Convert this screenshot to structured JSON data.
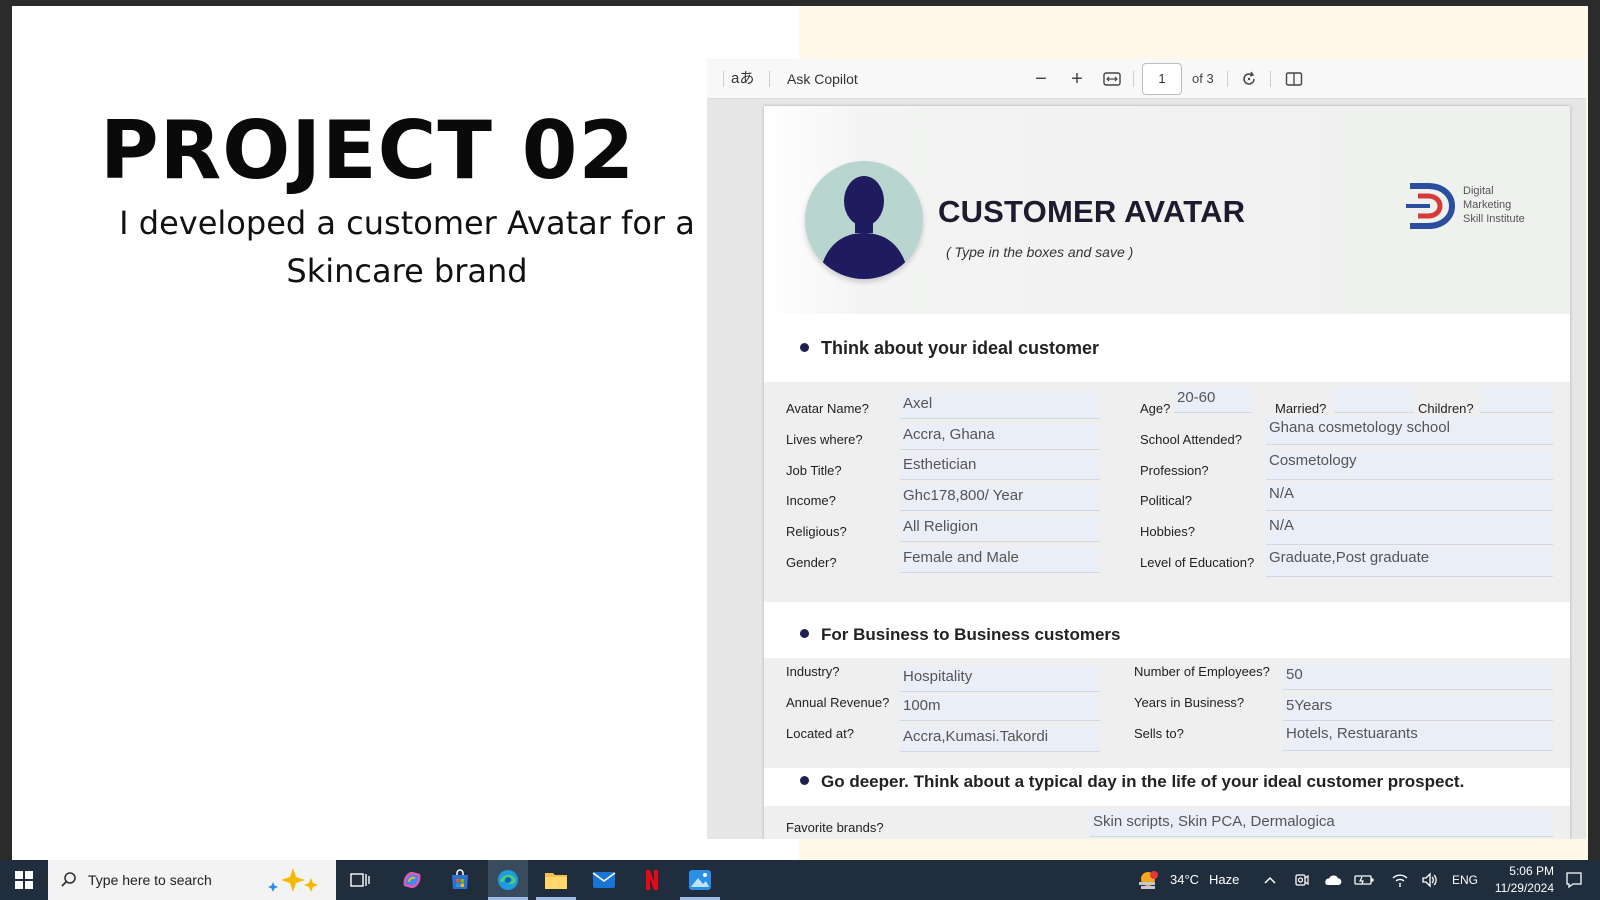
{
  "slide": {
    "title": "PROJECT 02",
    "subtitle": "I developed a customer Avatar for a Skincare brand"
  },
  "pdf_toolbar": {
    "translate_icon": "aあ",
    "ask_copilot": "Ask Copilot",
    "zoom_out": "−",
    "zoom_in": "+",
    "page_number": "1",
    "page_total": "of 3"
  },
  "document": {
    "title": "CUSTOMER AVATAR",
    "instruction": "( Type in the boxes and save )",
    "logo_lines": [
      "Digital",
      "Marketing",
      "Skill Institute"
    ],
    "section1_heading": "Think about your ideal customer",
    "section1": {
      "avatar_name_label": "Avatar Name?",
      "avatar_name": "Axel",
      "lives_label": "Lives where?",
      "lives": "Accra, Ghana",
      "job_label": "Job Title?",
      "job": "Esthetician",
      "income_label": "Income?",
      "income": "Ghc178,800/ Year",
      "religious_label": "Religious?",
      "religious": "All Religion",
      "gender_label": "Gender?",
      "gender": "Female and Male",
      "age_label": "Age?",
      "age": "20-60",
      "married_label": "Married?",
      "married": "",
      "children_label": "Children?",
      "children": "",
      "school_label": "School Attended?",
      "school": "Ghana cosmetology school",
      "profession_label": "Profession?",
      "profession": "Cosmetology",
      "political_label": "Political?",
      "political": "N/A",
      "hobbies_label": "Hobbies?",
      "hobbies": "N/A",
      "education_label": "Level of Education?",
      "education": "Graduate,Post graduate"
    },
    "section2_heading": "For Business to Business customers",
    "section2": {
      "industry_label": "Industry?",
      "industry": "Hospitality",
      "revenue_label": "Annual Revenue?",
      "revenue": "100m",
      "located_label": "Located at?",
      "located": "Accra,Kumasi.Takordi",
      "employees_label": "Number of Employees?",
      "employees": "50",
      "years_label": "Years in Business?",
      "years": "5Years",
      "sells_label": "Sells to?",
      "sells": "Hotels, Restuarants"
    },
    "section3_heading": "Go deeper. Think about a typical day in the life of your ideal customer prospect.",
    "section3": {
      "brands_label": "Favorite brands?",
      "brands": "Skin scripts, Skin PCA, Dermalogica"
    }
  },
  "taskbar": {
    "search_placeholder": "Type here to search",
    "weather_temp": "34°C",
    "weather_desc": "Haze",
    "language": "ENG",
    "time": "5:06 PM",
    "date": "11/29/2024"
  }
}
